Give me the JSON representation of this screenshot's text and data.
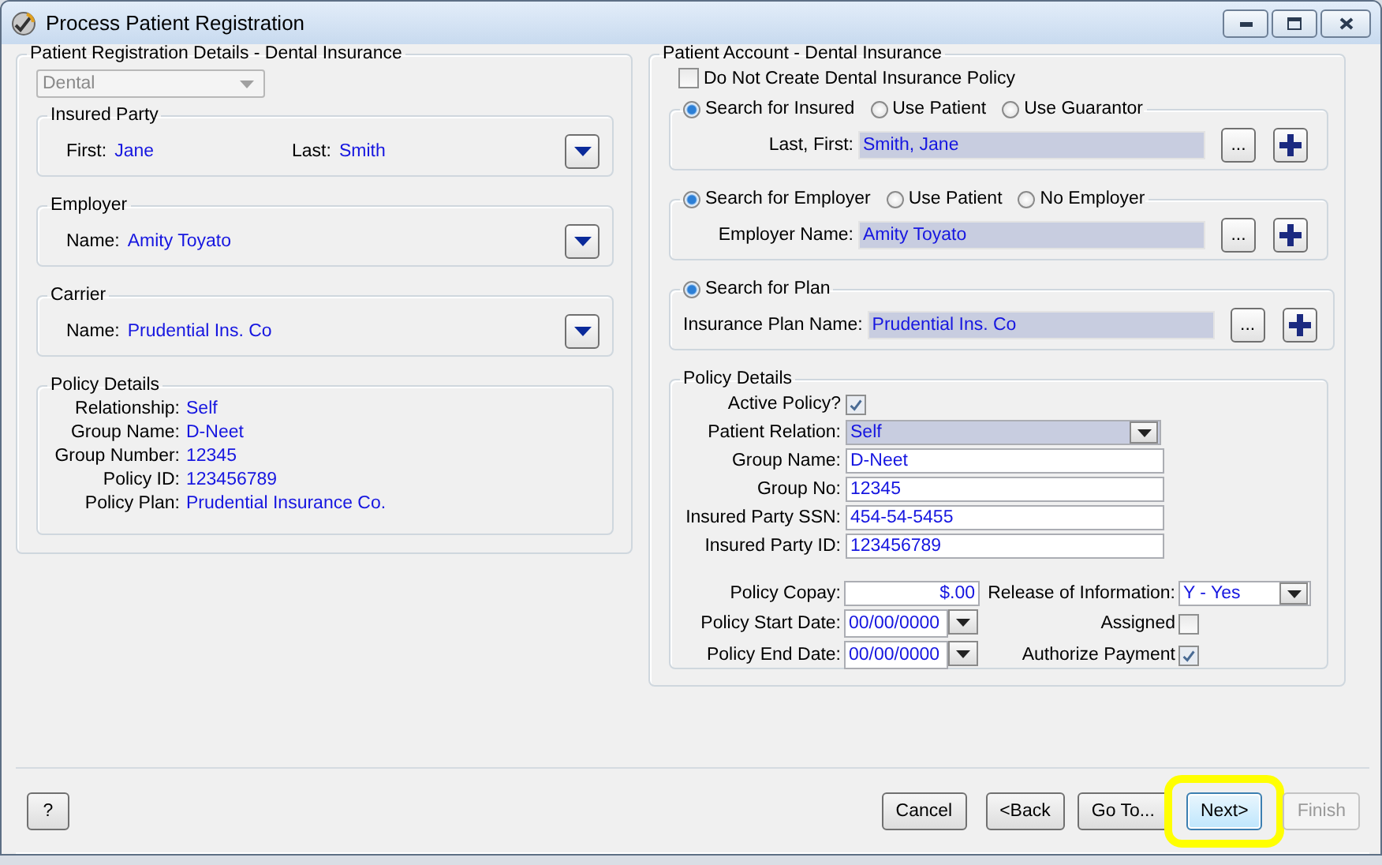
{
  "window": {
    "title": "Process Patient Registration"
  },
  "registration_details": {
    "title": "Patient Registration Details - Dental Insurance",
    "type_select": {
      "value": "Dental",
      "disabled": true
    },
    "sections": [
      {
        "title": "Insured Party",
        "fields": [
          {
            "label": "First:",
            "value": "Jane"
          },
          {
            "label": "Last:",
            "value": "Smith"
          }
        ]
      },
      {
        "title": "Employer",
        "fields": [
          {
            "label": "Name:",
            "value": "Amity Toyato"
          }
        ]
      },
      {
        "title": "Carrier",
        "fields": [
          {
            "label": "Name:",
            "value": "Prudential Ins. Co"
          }
        ]
      }
    ],
    "policy_details": {
      "title": "Policy Details",
      "rows": [
        {
          "label": "Relationship:",
          "value": "Self"
        },
        {
          "label": "Group Name:",
          "value": "D-Neet"
        },
        {
          "label": "Group Number:",
          "value": "12345"
        },
        {
          "label": "Policy ID:",
          "value": "123456789"
        },
        {
          "label": "Policy Plan:",
          "value": "Prudential Insurance Co."
        }
      ]
    }
  },
  "patient_account": {
    "title": "Patient Account - Dental Insurance",
    "do_not_create": {
      "label": "Do Not Create Dental Insurance Policy",
      "checked": false
    },
    "searches": [
      {
        "options": [
          {
            "label": "Search for Insured",
            "selected": true
          },
          {
            "label": "Use Patient",
            "selected": false
          },
          {
            "label": "Use Guarantor",
            "selected": false
          }
        ],
        "field_label": "Last, First:",
        "value": "Smith, Jane",
        "browse_label": "..."
      },
      {
        "options": [
          {
            "label": "Search for Employer",
            "selected": true
          },
          {
            "label": "Use Patient",
            "selected": false
          },
          {
            "label": "No Employer",
            "selected": false
          }
        ],
        "field_label": "Employer Name:",
        "value": "Amity Toyato",
        "browse_label": "..."
      },
      {
        "options": [
          {
            "label": "Search for Plan",
            "selected": true
          }
        ],
        "field_label": "Insurance Plan Name:",
        "value": "Prudential Ins. Co",
        "browse_label": "..."
      }
    ],
    "policy_details": {
      "title": "Policy Details",
      "fields": [
        {
          "kind": "checkbox",
          "label": "Active Policy?",
          "checked": true
        },
        {
          "kind": "dropdown",
          "label": "Patient Relation:",
          "value": "Self"
        },
        {
          "kind": "text",
          "label": "Group Name:",
          "value": "D-Neet"
        },
        {
          "kind": "text",
          "label": "Group No:",
          "value": "12345"
        },
        {
          "kind": "text",
          "label": "Insured Party SSN:",
          "value": "454-54-5455"
        },
        {
          "kind": "text",
          "label": "Insured Party ID:",
          "value": "123456789"
        }
      ],
      "left_fields": [
        {
          "kind": "amount",
          "label": "Policy Copay:",
          "value": "$.00"
        },
        {
          "kind": "date",
          "label": "Policy Start Date:",
          "value": "00/00/0000"
        },
        {
          "kind": "date",
          "label": "Policy End Date:",
          "value": "00/00/0000"
        }
      ],
      "right_fields": [
        {
          "kind": "dropdown",
          "label": "Release of Information:",
          "value": "Y - Yes"
        },
        {
          "kind": "checkbox",
          "label": "Assigned",
          "checked": false
        },
        {
          "kind": "checkbox",
          "label": "Authorize Payment",
          "checked": true
        }
      ]
    }
  },
  "footer": {
    "help_button": {
      "label": "?"
    },
    "buttons": [
      {
        "label": "Cancel",
        "disabled": false,
        "focused": false,
        "highlighted": false
      },
      {
        "label": "<Back",
        "disabled": false,
        "focused": false,
        "highlighted": false
      },
      {
        "label": "Go To...",
        "disabled": false,
        "focused": false,
        "highlighted": false
      },
      {
        "label": "Next>",
        "disabled": false,
        "focused": true,
        "highlighted": true
      },
      {
        "label": "Finish",
        "disabled": true,
        "focused": false,
        "highlighted": false
      }
    ]
  }
}
